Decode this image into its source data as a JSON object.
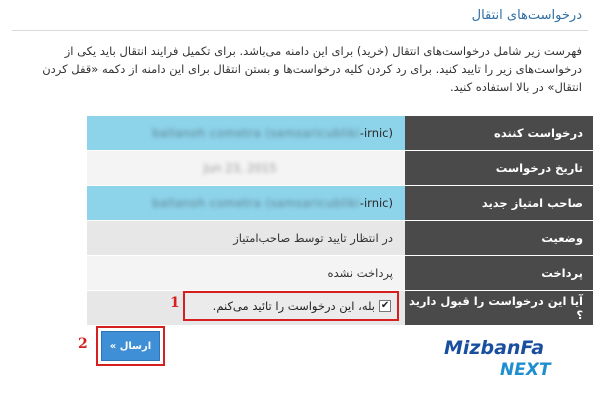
{
  "page": {
    "title": "درخواست‌های انتقال",
    "intro": "فهرست زیر شامل درخواست‌های انتقال (خرید) برای این دامنه می‌باشد. برای تکمیل فرایند انتقال باید یکی از درخواست‌های زیر را تایید کنید. برای رد کردن کلیه درخواست‌ها و بستن انتقال برای این دامنه از دکمه «قفل کردن انتقال» در بالا استفاده کنید."
  },
  "table": {
    "rows": [
      {
        "label": "درخواست کننده",
        "value_blurred": "ballanoh cometra (samsaricubliki",
        "value_suffix": "(irnic-",
        "highlight": "blue"
      },
      {
        "label": "تاریخ درخواست",
        "value_blurred": "Jun 23, 2015",
        "value_suffix": "",
        "highlight": "none"
      },
      {
        "label": "صاحب امتیاز جدید",
        "value_blurred": "ballanoh cometra (samsaricubliki",
        "value_suffix": "(irnic-",
        "highlight": "blue"
      },
      {
        "label": "وضعیت",
        "value": "در انتظار تایید توسط صاحب‌امتیاز"
      },
      {
        "label": "پرداخت",
        "value": "پرداخت نشده"
      },
      {
        "label": "آیا این درخواست را قبول دارید ؟",
        "value": ""
      }
    ]
  },
  "accept": {
    "label": "بله، این درخواست را تائید می‌کنم.",
    "checked": true
  },
  "markers": {
    "one": "1",
    "two": "2"
  },
  "submit": {
    "label": "ارسال »"
  },
  "logo": {
    "brand": "MizbanFa",
    "sub": "NEXT"
  },
  "colors": {
    "accent_red": "#d62020",
    "label_bg": "#4a4a4a",
    "highlight_blue": "#8dd3ea",
    "button_blue": "#3f8fd6",
    "title_blue": "#2f6fa5"
  }
}
